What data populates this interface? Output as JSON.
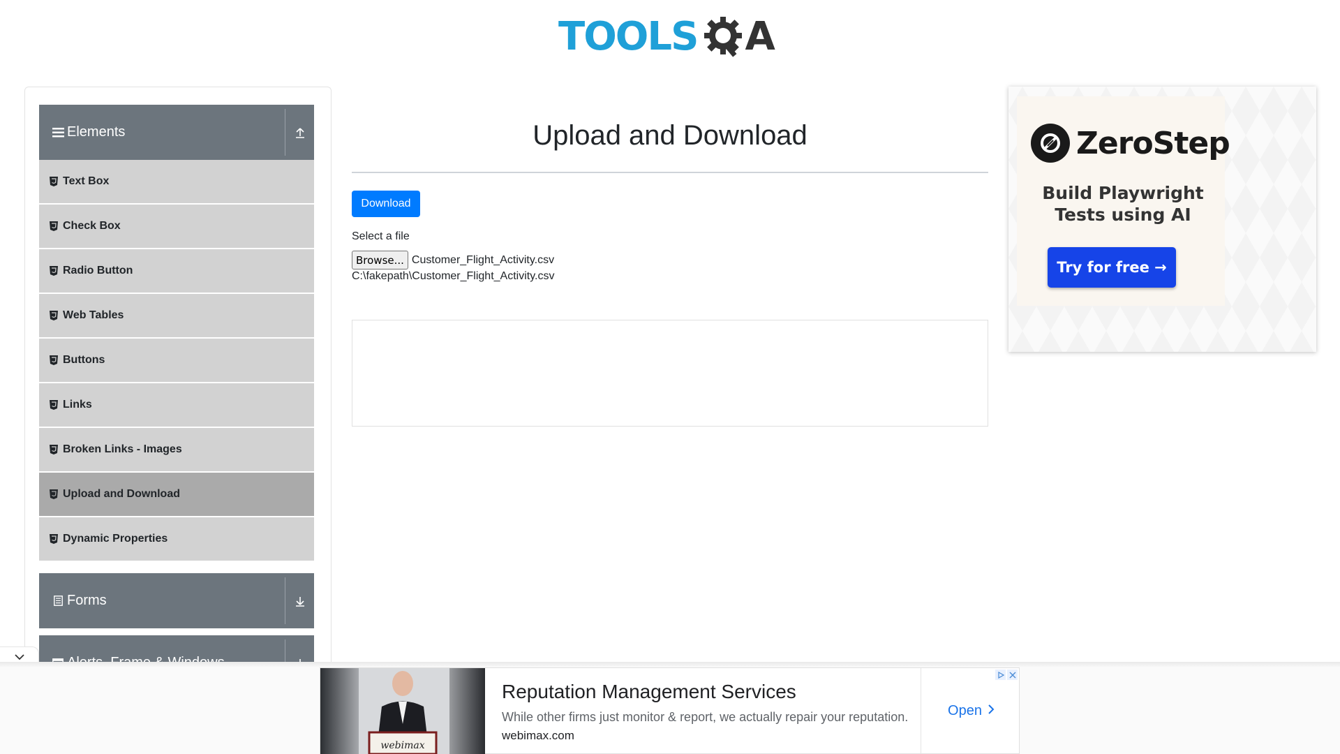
{
  "header": {
    "logo_text_left": "TOOLS",
    "logo_text_right": "A"
  },
  "sidebar": {
    "groups": [
      {
        "label": "Elements",
        "icon": "hamburger-icon",
        "toggle_icon": "collapse-up-icon",
        "expanded": true
      },
      {
        "label": "Forms",
        "icon": "form-icon",
        "toggle_icon": "expand-down-icon",
        "expanded": false
      },
      {
        "label": "Alerts, Frame & Windows",
        "icon": "window-icon",
        "toggle_icon": "expand-down-icon",
        "expanded": false
      }
    ],
    "items": [
      {
        "label": "Text Box",
        "active": false
      },
      {
        "label": "Check Box",
        "active": false
      },
      {
        "label": "Radio Button",
        "active": false
      },
      {
        "label": "Web Tables",
        "active": false
      },
      {
        "label": "Buttons",
        "active": false
      },
      {
        "label": "Links",
        "active": false
      },
      {
        "label": "Broken Links - Images",
        "active": false
      },
      {
        "label": "Upload and Download",
        "active": true
      },
      {
        "label": "Dynamic Properties",
        "active": false
      }
    ]
  },
  "main": {
    "title": "Upload and Download",
    "download_label": "Download",
    "select_file_label": "Select a file",
    "browse_label": "Browse...",
    "selected_file": "Customer_Flight_Activity.csv",
    "uploaded_path": "C:\\fakepath\\Customer_Flight_Activity.csv"
  },
  "ad_right": {
    "brand": "ZeroStep",
    "tagline_line1": "Build Playwright",
    "tagline_line2": "Tests using AI",
    "cta": "Try for free →"
  },
  "ad_bottom": {
    "title": "Reputation Management Services",
    "description": "While other firms just monitor & report, we actually repair your reputation.",
    "domain": "webimax.com",
    "open_label": "Open",
    "podium_text": "webimax"
  },
  "colors": {
    "primary": "#007bff",
    "group_header": "#6c757d",
    "menu_item": "#d2d2d2",
    "menu_item_active": "#aaaaaa",
    "logo_blue": "#1fa0d8",
    "cta_blue": "#1644e8"
  }
}
